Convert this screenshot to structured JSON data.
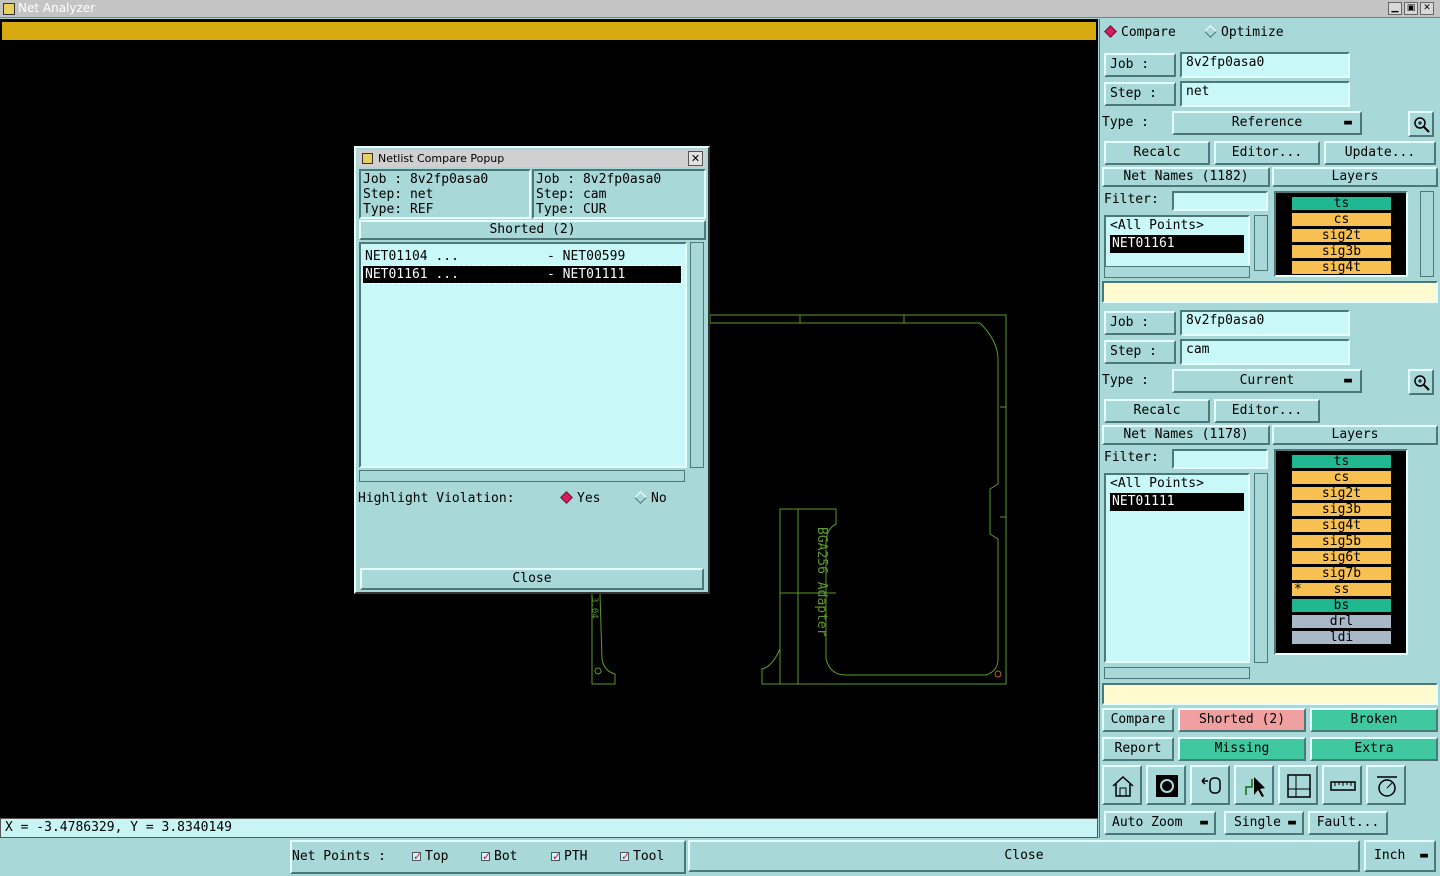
{
  "window": {
    "title": "Net Analyzer"
  },
  "status": {
    "coords": "X = -3.4786329, Y = 3.8340149"
  },
  "bottom": {
    "net_points_label": "Net Points :",
    "checks": [
      "Top",
      "Bot",
      "PTH",
      "Tool"
    ],
    "close_label": "Close",
    "units": "Inch"
  },
  "canvas": {
    "board_text": "BGA256 Adapter",
    "small_text": "3.04"
  },
  "mode": {
    "compare_label": "Compare",
    "optimize_label": "Optimize",
    "selected": "Compare"
  },
  "ref": {
    "job_label": "Job :",
    "job_value": "8v2fp0asa0",
    "step_label": "Step :",
    "step_value": "net",
    "type_label": "Type :",
    "type_value": "Reference",
    "recalc": "Recalc",
    "editor": "Editor...",
    "update": "Update...",
    "net_names_header": "Net Names (1182)",
    "layers_header": "Layers",
    "filter_label": "Filter:",
    "nets": [
      "<All Points>",
      "NET01161"
    ],
    "selected_net": "NET01161",
    "layers": [
      {
        "name": "ts",
        "color": "#20b890"
      },
      {
        "name": "cs",
        "color": "#f8c050"
      },
      {
        "name": "sig2t",
        "color": "#f8c050"
      },
      {
        "name": "sig3b",
        "color": "#f8c050"
      },
      {
        "name": "sig4t",
        "color": "#f8c050"
      }
    ]
  },
  "cur": {
    "job_label": "Job :",
    "job_value": "8v2fp0asa0",
    "step_label": "Step :",
    "step_value": "cam",
    "type_label": "Type :",
    "type_value": "Current",
    "recalc": "Recalc",
    "editor": "Editor...",
    "net_names_header": "Net Names (1178)",
    "layers_header": "Layers",
    "filter_label": "Filter:",
    "nets": [
      "<All Points>",
      "NET01111"
    ],
    "selected_net": "NET01111",
    "layers": [
      {
        "name": "ts",
        "color": "#20b890",
        "mark": ""
      },
      {
        "name": "cs",
        "color": "#f8c050",
        "mark": ""
      },
      {
        "name": "sig2t",
        "color": "#f8c050",
        "mark": ""
      },
      {
        "name": "sig3b",
        "color": "#f8c050",
        "mark": ""
      },
      {
        "name": "sig4t",
        "color": "#f8c050",
        "mark": ""
      },
      {
        "name": "sig5b",
        "color": "#f8c050",
        "mark": ""
      },
      {
        "name": "sig6t",
        "color": "#f8c050",
        "mark": ""
      },
      {
        "name": "sig7b",
        "color": "#f8c050",
        "mark": ""
      },
      {
        "name": "ss",
        "color": "#f8c050",
        "mark": "*"
      },
      {
        "name": "bs",
        "color": "#20b890",
        "mark": ""
      },
      {
        "name": "drl",
        "color": "#a8b8c8",
        "mark": ""
      },
      {
        "name": "ldi",
        "color": "#a8b8c8",
        "mark": ""
      }
    ]
  },
  "actions": {
    "compare": "Compare",
    "shorted": "Shorted (2)",
    "broken": "Broken",
    "report": "Report",
    "missing": "Missing",
    "extra": "Extra",
    "auto_zoom": "Auto Zoom",
    "single": "Single",
    "fault": "Fault...",
    "colors": {
      "shorted": "#f0a0a0",
      "green": "#40c8a0"
    },
    "tools": [
      "home-icon",
      "camera-icon",
      "undo-icon",
      "pointer-icon",
      "window-icon",
      "ruler-icon",
      "measure-icon"
    ]
  },
  "popup": {
    "title": "Netlist Compare Popup",
    "left": {
      "job": "Job : 8v2fp0asa0",
      "step": "Step: net",
      "type": "Type: REF"
    },
    "right": {
      "job": "Job : 8v2fp0asa0",
      "step": "Step: cam",
      "type": "Type: CUR"
    },
    "list_header": "Shorted (2)",
    "rows": [
      {
        "a": "NET01104 ...",
        "b": "- NET00599",
        "selected": false
      },
      {
        "a": "NET01161 ...",
        "b": "- NET01111",
        "selected": true
      }
    ],
    "highlight_label": "Highlight Violation:",
    "yes": "Yes",
    "no": "No",
    "close": "Close"
  }
}
